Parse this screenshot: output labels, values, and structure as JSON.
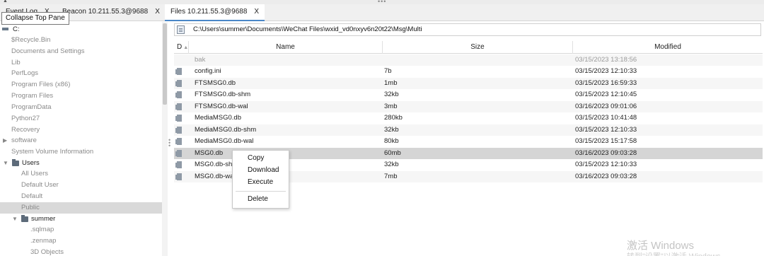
{
  "tabs": [
    {
      "label": "Event Log",
      "close": "X"
    },
    {
      "label": "Beacon 10.211.55.3@9688",
      "close": "X"
    },
    {
      "label": "Files 10.211.55.3@9688",
      "close": "X"
    }
  ],
  "tooltip": "Collapse Top Pane",
  "tree": {
    "drive": "C:",
    "items": [
      "$Recycle.Bin",
      "Documents and Settings",
      "Lib",
      "PerfLogs",
      "Program Files (x86)",
      "Program Files",
      "ProgramData",
      "Python27",
      "Recovery",
      "software",
      "System Volume Information",
      "Users",
      "All Users",
      "Default User",
      "Default",
      "Public",
      "summer",
      ".sqlmap",
      ".zenmap",
      "3D Objects"
    ]
  },
  "path": "C:\\Users\\summer\\Documents\\WeChat Files\\wxid_vd0nxyv6n20t22\\Msg\\Multi",
  "columns": {
    "d": "D",
    "name": "Name",
    "size": "Size",
    "modified": "Modified"
  },
  "files": [
    {
      "name": "bak",
      "size": "",
      "modified": "03/15/2023 13:18:56"
    },
    {
      "name": "config.ini",
      "size": "7b",
      "modified": "03/15/2023 12:10:33"
    },
    {
      "name": "FTSMSG0.db",
      "size": "1mb",
      "modified": "03/15/2023 16:59:33"
    },
    {
      "name": "FTSMSG0.db-shm",
      "size": "32kb",
      "modified": "03/15/2023 12:10:45"
    },
    {
      "name": "FTSMSG0.db-wal",
      "size": "3mb",
      "modified": "03/16/2023 09:01:06"
    },
    {
      "name": "MediaMSG0.db",
      "size": "280kb",
      "modified": "03/15/2023 10:41:48"
    },
    {
      "name": "MediaMSG0.db-shm",
      "size": "32kb",
      "modified": "03/15/2023 12:10:33"
    },
    {
      "name": "MediaMSG0.db-wal",
      "size": "80kb",
      "modified": "03/15/2023 15:17:58"
    },
    {
      "name": "MSG0.db",
      "size": "60mb",
      "modified": "03/16/2023 09:03:28"
    },
    {
      "name": "MSG0.db-sh",
      "size": "32kb",
      "modified": "03/15/2023 12:10:33"
    },
    {
      "name": "MSG0.db-wa",
      "size": "7mb",
      "modified": "03/16/2023 09:03:28"
    }
  ],
  "context_menu": [
    "Copy",
    "Download",
    "Execute",
    "Delete"
  ],
  "watermark": {
    "line1": "激活 Windows",
    "line2": "转到\"设置\"以激活 Windows"
  }
}
